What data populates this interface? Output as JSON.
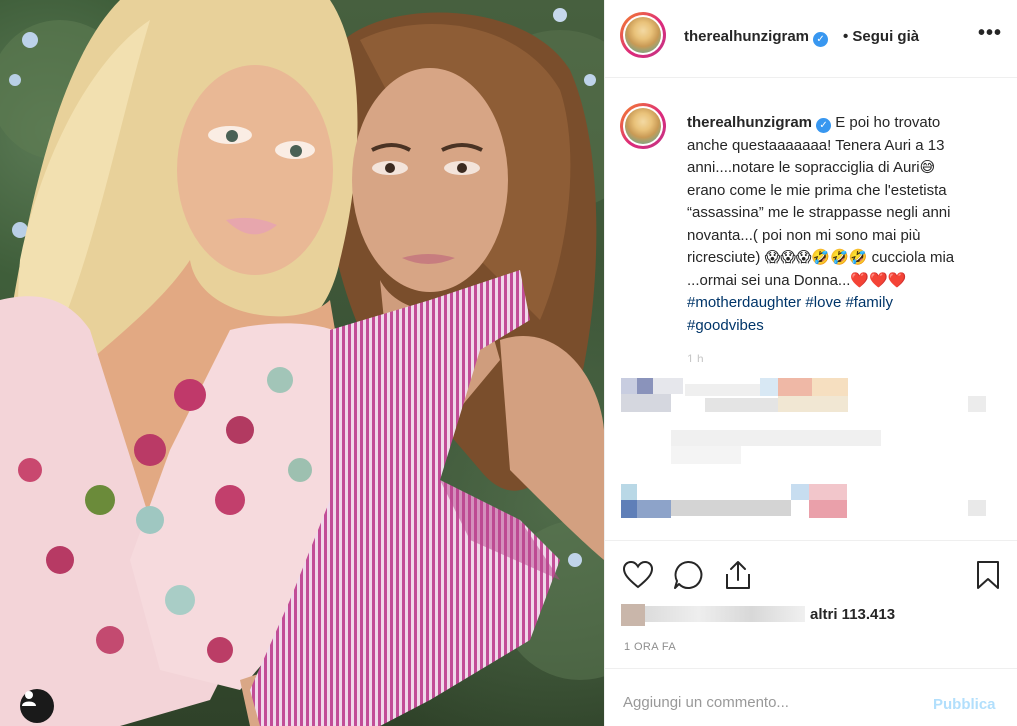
{
  "post": {
    "username": "therealhunzigram",
    "follow_status": "• Segui già",
    "more_icon": "•••",
    "caption_lines": [
      "E poi ho trovato",
      "anche questaaaaaaa! Tenera Auri a 13",
      "anni....notare le sopracciglia di Auri😅",
      "erano come le mie prima che l'estetista",
      "“assassina” me le strappasse negli anni",
      "novanta...( poi non mi sono mai più",
      "ricresciute) 😱😱😱🤣🤣🤣 cucciola mia",
      "...ormai sei una Donna...❤️❤️❤️"
    ],
    "hashtags_line1": [
      "#motherdaughter",
      "#love",
      "#family"
    ],
    "hashtags_line2": [
      "#goodvibes"
    ],
    "caption_time_partial": "1 h",
    "likes_suffix": "altri 113.413",
    "post_time": "1 ORA FA",
    "comment_placeholder": "Aggiungi un commento...",
    "publish_label": "Pubblica"
  },
  "icons": [
    "user-tag-icon",
    "verified-icon",
    "more-options-icon",
    "heart-icon",
    "comment-icon",
    "share-icon",
    "bookmark-icon"
  ],
  "colors": {
    "link_blue": "#003569",
    "verified_blue": "#3897f0",
    "publish_disabled": "#b2dffc",
    "secondary_text": "#8e8e8e"
  }
}
